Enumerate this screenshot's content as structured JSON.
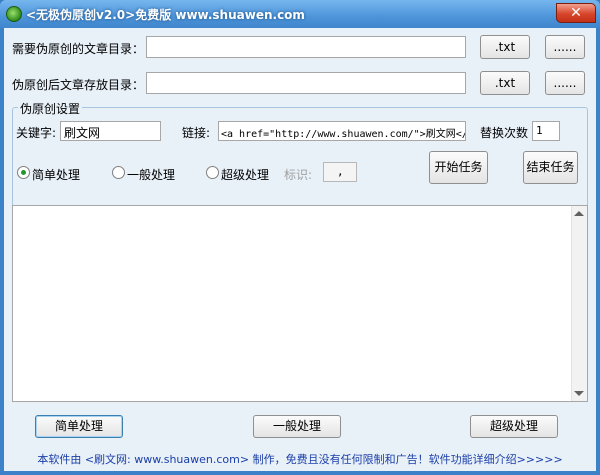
{
  "window": {
    "title": "<无极伪原创v2.0>免费版 www.shuawen.com",
    "close_glyph": "✕"
  },
  "source_dir": {
    "label": "需要伪原创的文章目录：",
    "value": "",
    "ext_button": ".txt",
    "browse_button": "......"
  },
  "output_dir": {
    "label": "伪原创后文章存放目录：",
    "value": "",
    "ext_button": ".txt",
    "browse_button": "......"
  },
  "settings": {
    "group_title": "伪原创设置",
    "keyword_label": "关键字:",
    "keyword_value": "刷文网",
    "link_label": "链接:",
    "link_value": "<a href=\"http://www.shuawen.com/\">刷文网</a>",
    "replace_count_label": "替换次数",
    "replace_count_value": "1",
    "modes": [
      {
        "label": "简单处理",
        "checked": true
      },
      {
        "label": "一般处理",
        "checked": false
      },
      {
        "label": "超级处理",
        "checked": false
      }
    ],
    "marker_label": "标识:",
    "marker_value": ",",
    "start_button": "开始任务",
    "stop_button": "结束任务"
  },
  "bottom_buttons": {
    "simple": "简单处理",
    "normal": "一般处理",
    "super": "超级处理"
  },
  "footer": "本软件由 <刷文网: www.shuawen.com> 制作，免费且没有任何限制和广告！软件功能详细介绍>>>>>"
}
